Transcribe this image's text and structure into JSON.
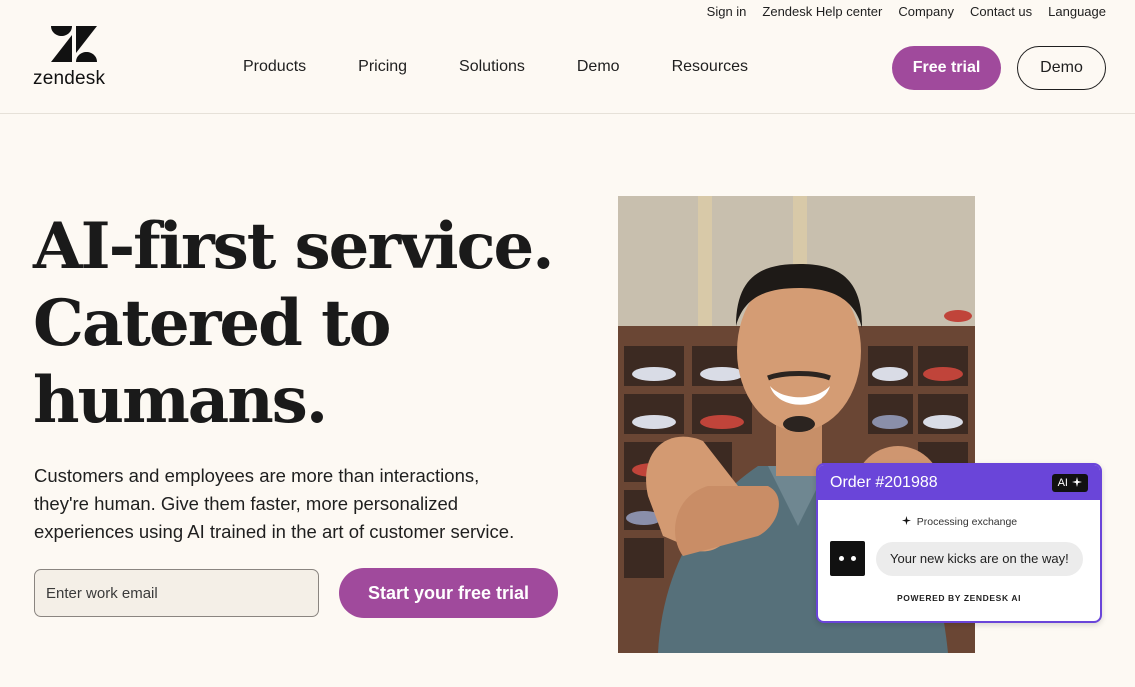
{
  "utility_nav": [
    "Sign in",
    "Zendesk Help center",
    "Company",
    "Contact us",
    "Language"
  ],
  "logo": {
    "wordmark": "zendesk"
  },
  "main_nav": [
    "Products",
    "Pricing",
    "Solutions",
    "Demo",
    "Resources"
  ],
  "header_buttons": {
    "free_trial": "Free trial",
    "demo": "Demo"
  },
  "hero": {
    "title_lines": [
      "AI-first service.",
      "Catered to",
      "humans."
    ],
    "subtitle_lines": [
      "Customers and employees are more than interactions,",
      "they're human. Give them faster, more personalized",
      "experiences using AI trained in the art of customer service."
    ],
    "email_placeholder": "Enter work email",
    "cta": "Start your free trial"
  },
  "chat_card": {
    "order": "Order #201988",
    "badge": "AI",
    "status": "Processing exchange",
    "message": "Your new kicks are on the way!",
    "footer": "POWERED BY ZENDESK AI"
  },
  "colors": {
    "brand_purple": "#a04a9c",
    "ai_purple": "#6a45d9",
    "background": "#fdf9f3"
  }
}
